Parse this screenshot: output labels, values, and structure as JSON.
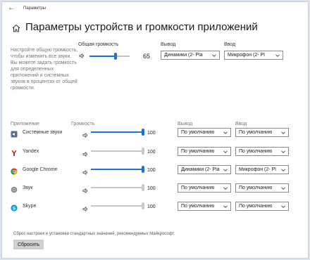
{
  "window": {
    "back_icon": "arrow-left-icon",
    "title": "Параметры"
  },
  "page": {
    "home_icon": "home-icon",
    "heading": "Параметры устройств и громкости приложений"
  },
  "master": {
    "description": "Настройте общую громкость, чтобы изменить все звуки. Вы можете задать громкость для определенных приложений и системных звуков в процентах от общей громкости.",
    "volume_label": "Общая громкость",
    "volume": 65,
    "output_label": "Вывод",
    "output_value": "Динамики (2- Pla",
    "input_label": "Ввод",
    "input_value": "Микрофон (2- Pl"
  },
  "columns": {
    "app": "Приложение",
    "volume": "Громкость",
    "output": "Вывод",
    "input": "Ввод"
  },
  "apps": [
    {
      "name": "Системные звуки",
      "icon": "system-sounds-icon",
      "volume": 100,
      "active": true,
      "output": "По умолчанию",
      "input": "По умолчанию"
    },
    {
      "name": "Yandex",
      "icon": "yandex-icon",
      "volume": 100,
      "active": false,
      "output": "По умолчанию",
      "input": "По умолчанию"
    },
    {
      "name": "Google Chrome",
      "icon": "chrome-icon",
      "volume": 100,
      "active": true,
      "output": "Динамики (2- Pla",
      "input": "Микрофон (2- Pl"
    },
    {
      "name": "Звук",
      "icon": "sound-app-icon",
      "volume": 100,
      "active": false,
      "output": "По умолчанию",
      "input": "По умолчанию"
    },
    {
      "name": "Skype",
      "icon": "skype-icon",
      "volume": 100,
      "active": false,
      "output": "По умолчанию",
      "input": "По умолчанию"
    }
  ],
  "footer": {
    "text": "Сброс настроек и установка стандартных значений, рекомендуемых Майкрософт.",
    "reset_label": "Сбросить"
  },
  "colors": {
    "accent": "#1a73d8",
    "track": "#c4c4c4",
    "inactive_thumb": "#c8c8c8",
    "button": "#cfcfcf"
  }
}
